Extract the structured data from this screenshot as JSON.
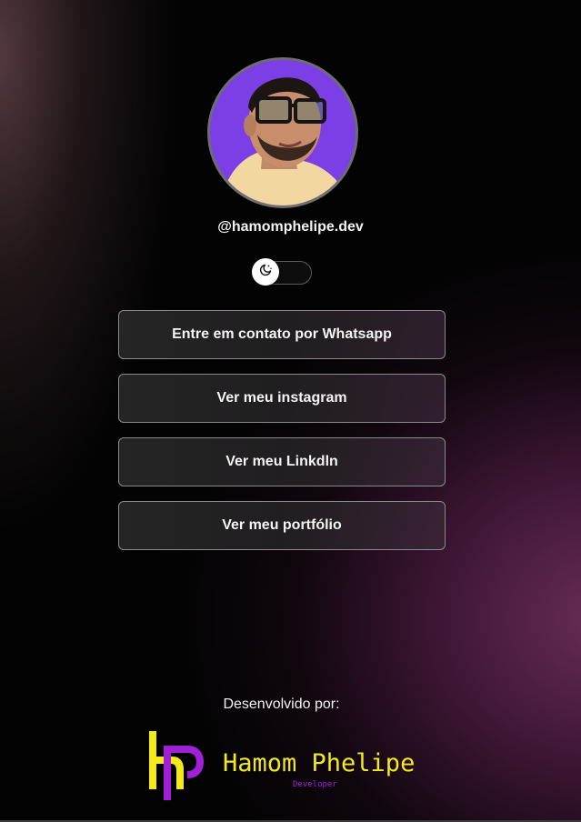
{
  "profile": {
    "handle": "@hamomphelipe.dev"
  },
  "theme_toggle": {
    "icon": "moon-stars-icon",
    "state": "off"
  },
  "links": [
    {
      "label": "Entre em contato por Whatsapp"
    },
    {
      "label": "Ver meu instagram"
    },
    {
      "label": "Ver meu Linkdln"
    },
    {
      "label": "Ver meu portfólio"
    }
  ],
  "footer": {
    "credit_label": "Desenvolvido por:",
    "logo_name": "Hamom Phelipe",
    "logo_subtitle": "Developer",
    "logo_colors": {
      "yellow": "#f2ea1c",
      "purple": "#a020d8"
    }
  }
}
